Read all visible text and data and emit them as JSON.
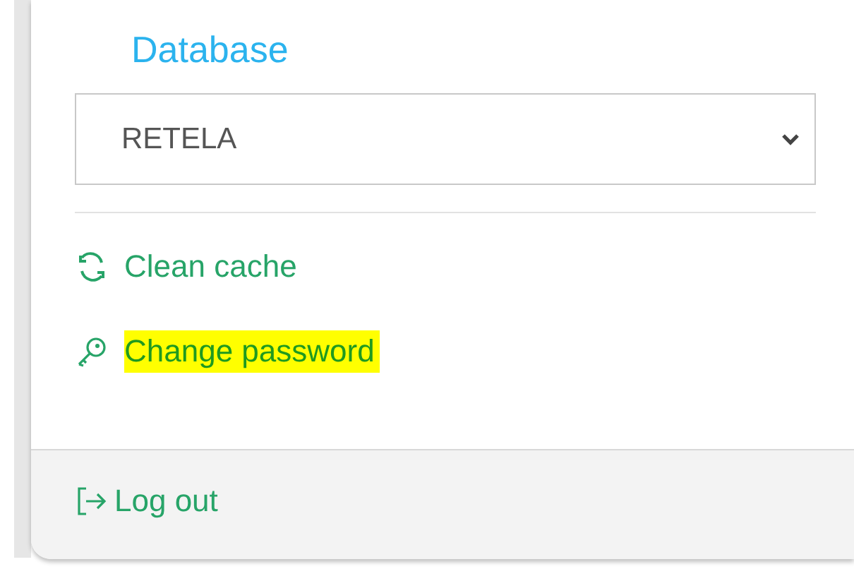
{
  "database": {
    "label": "Database",
    "value": "RETELA"
  },
  "menu": [
    {
      "kind": "refresh",
      "label": "Clean cache",
      "highlighted": false
    },
    {
      "kind": "key",
      "label": "Change password",
      "highlighted": true
    }
  ],
  "footer": {
    "kind": "logout",
    "label": "Log out"
  }
}
